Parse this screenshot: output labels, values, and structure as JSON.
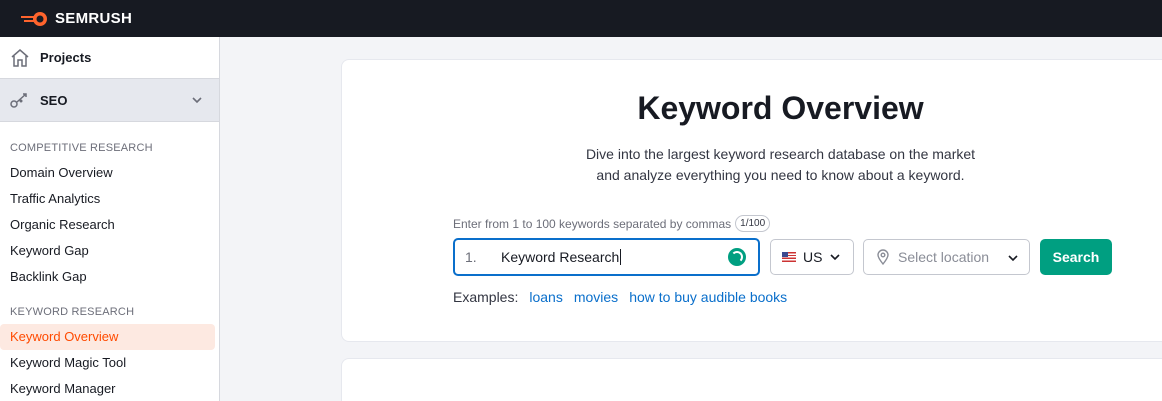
{
  "topbar": {
    "brand": "SEMRUSH"
  },
  "sidebar": {
    "projects_label": "Projects",
    "seo_label": "SEO",
    "sections": [
      {
        "heading": "COMPETITIVE RESEARCH",
        "items": [
          "Domain Overview",
          "Traffic Analytics",
          "Organic Research",
          "Keyword Gap",
          "Backlink Gap"
        ]
      },
      {
        "heading": "KEYWORD RESEARCH",
        "items": [
          "Keyword Overview",
          "Keyword Magic Tool",
          "Keyword Manager"
        ]
      }
    ],
    "active_item": "Keyword Overview"
  },
  "main": {
    "title": "Keyword Overview",
    "subtitle_line1": "Dive into the largest keyword research database on the market",
    "subtitle_line2": "and analyze everything you need to know about a keyword.",
    "hint": "Enter from 1 to 100 keywords separated by commas",
    "counter": "1/100",
    "input": {
      "line_number": "1.",
      "value": "Keyword Research"
    },
    "database": {
      "value": "US"
    },
    "location": {
      "placeholder": "Select location"
    },
    "search_label": "Search",
    "examples_label": "Examples:",
    "examples": [
      "loans",
      "movies",
      "how to buy audible books"
    ]
  },
  "colors": {
    "accent": "#ff4a00",
    "primary_button": "#009f81",
    "link": "#0a6fcb",
    "topbar": "#171a22"
  },
  "icons": [
    "semrush-logo",
    "home-icon",
    "seo-icon",
    "chevron-down-icon",
    "spinner-icon",
    "us-flag-icon",
    "location-pin-icon"
  ]
}
